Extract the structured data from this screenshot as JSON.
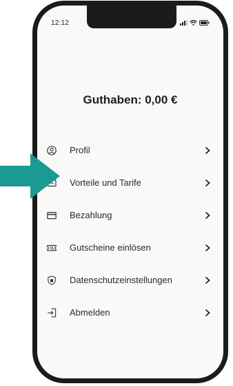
{
  "status_bar": {
    "time": "12:12"
  },
  "balance": {
    "text": "Guthaben: 0,00 €"
  },
  "menu": {
    "items": [
      {
        "label": "Profil",
        "icon": "user-circle-icon"
      },
      {
        "label": "Vorteile und Tarife",
        "icon": "ticket-icon"
      },
      {
        "label": "Bezahlung",
        "icon": "credit-card-icon"
      },
      {
        "label": "Gutscheine einlösen",
        "icon": "voucher-percent-icon"
      },
      {
        "label": "Datenschutzeinstellungen",
        "icon": "shield-icon"
      },
      {
        "label": "Abmelden",
        "icon": "logout-icon"
      }
    ]
  },
  "colors": {
    "arrow": "#1a9a92",
    "phone_frame": "#1b1b1b",
    "screen_bg": "#faf9f7"
  }
}
